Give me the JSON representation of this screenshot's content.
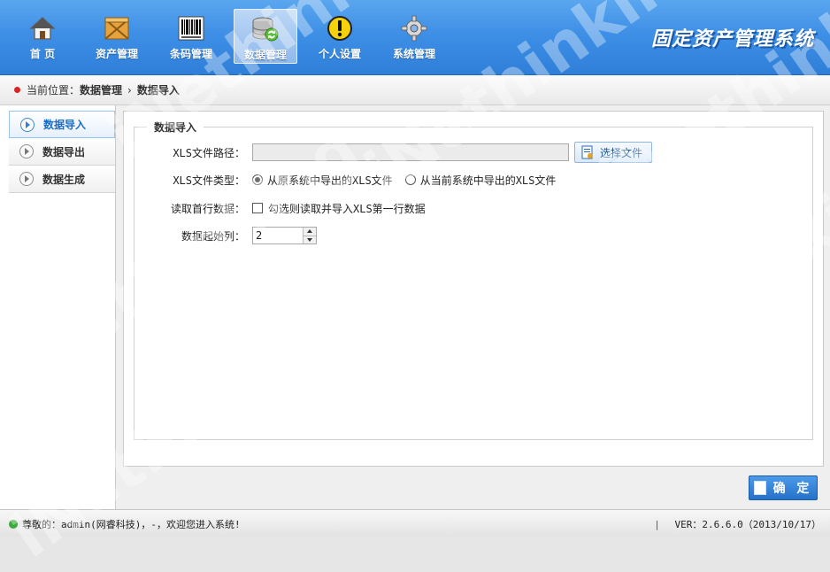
{
  "header": {
    "nav": [
      {
        "label": "首 页",
        "icon": "home-icon"
      },
      {
        "label": "资产管理",
        "icon": "box-icon"
      },
      {
        "label": "条码管理",
        "icon": "barcode-icon"
      },
      {
        "label": "数据管理",
        "icon": "database-icon",
        "active": true
      },
      {
        "label": "个人设置",
        "icon": "warning-icon"
      },
      {
        "label": "系统管理",
        "icon": "gear-icon"
      }
    ],
    "logo_text": "固定资产管理系统"
  },
  "breadcrumb": {
    "prefix": "当前位置：",
    "section": "数据管理",
    "separator": "›",
    "page": "数据导入"
  },
  "sidebar": {
    "items": [
      {
        "label": "数据导入",
        "active": true
      },
      {
        "label": "数据导出"
      },
      {
        "label": "数据生成"
      }
    ]
  },
  "form": {
    "legend": "数据导入",
    "path_label": "XLS文件路径：",
    "path_value": "",
    "choose_file_label": "选择文件",
    "type_label": "XLS文件类型：",
    "type_options": [
      {
        "label": "从原系统中导出的XLS文件",
        "checked": true
      },
      {
        "label": "从当前系统中导出的XLS文件",
        "checked": false
      }
    ],
    "first_row_label": "读取首行数据：",
    "first_row_checkbox_label": "勾选则读取并导入XLS第一行数据",
    "start_col_label": "数据起始列：",
    "start_col_value": "2",
    "confirm_label": "确 定"
  },
  "footer": {
    "greeting": "尊敬的：admin(网睿科技)，-，欢迎您进入系统!",
    "version": "VER：2.6.6.0（2013/10/17）"
  },
  "watermark": "iNethinking",
  "colors": {
    "header": "#3e8fe6",
    "accent": "#2f7fd9",
    "status": "#3caa3c"
  }
}
